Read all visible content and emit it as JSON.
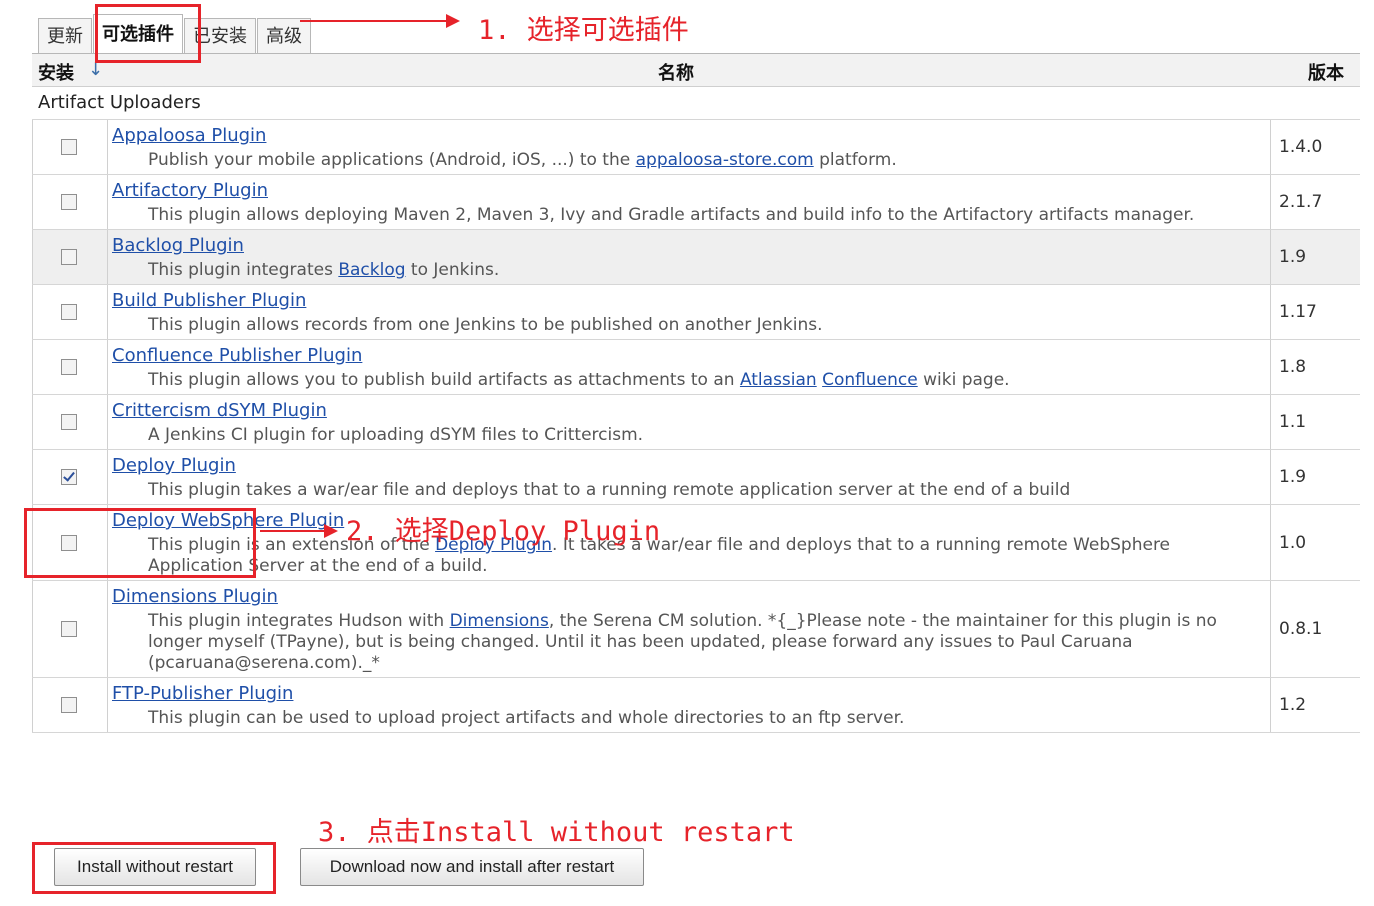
{
  "tabs": [
    {
      "label": "更新",
      "active": false
    },
    {
      "label": "可选插件",
      "active": true
    },
    {
      "label": "已安装",
      "active": false
    },
    {
      "label": "高级",
      "active": false
    }
  ],
  "table": {
    "header": {
      "install": "安装",
      "sort_arrow": "↓",
      "name": "名称",
      "version": "版本"
    },
    "category": "Artifact Uploaders",
    "rows": [
      {
        "name": "Appaloosa Plugin",
        "desc_parts": [
          "Publish your mobile applications (Android, iOS, ...) to the ",
          "appaloosa-store.com",
          " platform."
        ],
        "version": "1.4.0",
        "checked": false
      },
      {
        "name": "Artifactory Plugin",
        "desc": "This plugin allows deploying Maven 2, Maven 3, Ivy and Gradle artifacts and build info to the Artifactory artifacts manager.",
        "version": "2.1.7",
        "checked": false
      },
      {
        "name": "Backlog Plugin",
        "desc_parts": [
          "This plugin integrates ",
          "Backlog",
          " to Jenkins."
        ],
        "version": "1.9",
        "checked": false
      },
      {
        "name": "Build Publisher Plugin",
        "desc": "This plugin allows records from one Jenkins to be published on another Jenkins.",
        "version": "1.17",
        "checked": false
      },
      {
        "name": "Confluence Publisher Plugin",
        "desc_parts": [
          "This plugin allows you to publish build artifacts as attachments to an ",
          "Atlassian",
          " ",
          "Confluence",
          " wiki page."
        ],
        "version": "1.8",
        "checked": false
      },
      {
        "name": "Crittercism dSYM Plugin",
        "desc": "A Jenkins CI plugin for uploading dSYM files to Crittercism.",
        "version": "1.1",
        "checked": false
      },
      {
        "name": "Deploy Plugin",
        "desc": "This plugin takes a war/ear file and deploys that to a running remote application server at the end of a build",
        "version": "1.9",
        "checked": true
      },
      {
        "name": "Deploy WebSphere Plugin",
        "desc_parts": [
          "This plugin is an extension of the ",
          "Deploy Plugin",
          ". It takes a war/ear file and deploys that to a running remote WebSphere Application Server at the end of a build."
        ],
        "version": "1.0",
        "checked": false
      },
      {
        "name": "Dimensions Plugin",
        "desc_parts": [
          "This plugin integrates Hudson with ",
          "Dimensions",
          ", the Serena CM solution. *{_}Please note - the maintainer for this plugin is no longer myself (TPayne), but is being changed. Until it has been updated, please forward any issues to Paul Caruana (pcaruana@serena.com)._*"
        ],
        "version": "0.8.1",
        "checked": false
      },
      {
        "name": "FTP-Publisher Plugin",
        "desc": "This plugin can be used to upload project artifacts and whole directories to an ftp server.",
        "version": "1.2",
        "checked": false
      }
    ]
  },
  "buttons": {
    "install_now": "Install without restart",
    "install_after": "Download now and install after restart"
  },
  "annotations": {
    "step1": "1. 选择可选插件",
    "step2": "2. 选择Deploy Plugin",
    "step3": "3. 点击Install without restart",
    "accent_color": "#e6232a"
  }
}
